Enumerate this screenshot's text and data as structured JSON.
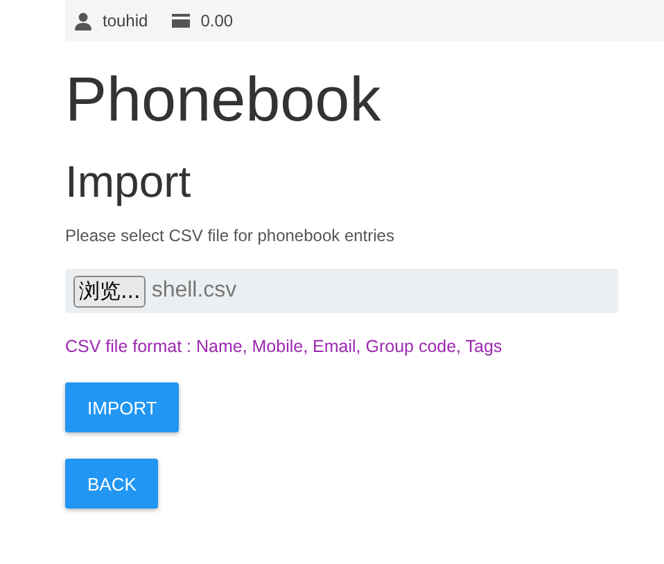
{
  "top_bar": {
    "username": "touhid",
    "balance": "0.00"
  },
  "title": "Phonebook",
  "section_title": "Import",
  "instruction": "Please select CSV file for phonebook entries",
  "file_input": {
    "button": "浏览...",
    "value": "shell.csv"
  },
  "format_note": "CSV file format : Name, Mobile, Email, Group code, Tags",
  "buttons": [
    "IMPORT",
    "BACK"
  ]
}
